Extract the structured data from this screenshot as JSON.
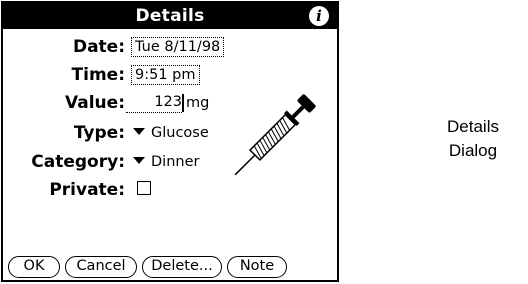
{
  "dialog": {
    "title": "Details",
    "info_icon": "info-icon",
    "fields": {
      "date_label": "Date:",
      "date_value": "Tue 8/11/98",
      "time_label": "Time:",
      "time_value": "9:51 pm",
      "value_label": "Value:",
      "value_value": "123",
      "value_unit": "mg",
      "type_label": "Type:",
      "type_value": "Glucose",
      "category_label": "Category:",
      "category_value": "Dinner",
      "private_label": "Private:",
      "private_checked": false
    },
    "buttons": {
      "ok": "OK",
      "cancel": "Cancel",
      "delete": "Delete...",
      "note": "Note"
    },
    "illustration": "syringe-icon"
  },
  "caption": {
    "line1": "Details",
    "line2": "Dialog"
  }
}
